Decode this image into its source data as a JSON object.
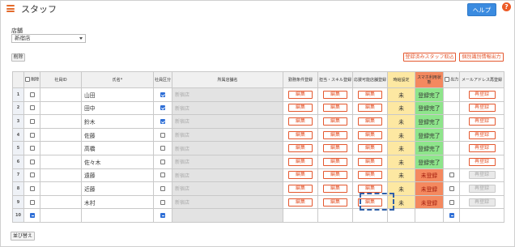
{
  "app": {
    "title": "スタッフ",
    "help_label": "ヘルプ",
    "help_icon": "?"
  },
  "store": {
    "label": "店舗",
    "selected": "新宿店"
  },
  "toolbar": {
    "delete_label": "削除",
    "sort_label": "並び替え"
  },
  "actions": {
    "registered_out_label": "登録済みスタッフ取込",
    "individual_out_label": "個別識別情報出力"
  },
  "columns": {
    "delete": "削除",
    "staff_id": "社員ID",
    "name": "氏名*",
    "staff_type": "社員区分",
    "store": "所属店舗名",
    "work_cond": "勤務条件登録",
    "skill": "担当・スキル登録",
    "shop_avail": "応援可能店舗登録",
    "time_set": "時給設定",
    "phone": "スマホ利用状態",
    "output": "出力",
    "mail": "メールアドレス再登録"
  },
  "labels": {
    "edit": "編集",
    "rereg": "再登録"
  },
  "rows": [
    {
      "num": "1",
      "name": "山田",
      "type_checked": true,
      "store": "新宿店",
      "time": "未",
      "phone": "登録完了",
      "phone_state": "ok",
      "output_cb": false,
      "rereg_enabled": true
    },
    {
      "num": "2",
      "name": "田中",
      "type_checked": true,
      "store": "新宿店",
      "time": "未",
      "phone": "登録完了",
      "phone_state": "ok",
      "output_cb": false,
      "rereg_enabled": true
    },
    {
      "num": "3",
      "name": "鈴木",
      "type_checked": true,
      "store": "新宿店",
      "time": "未",
      "phone": "登録完了",
      "phone_state": "ok",
      "output_cb": false,
      "rereg_enabled": true
    },
    {
      "num": "4",
      "name": "佐藤",
      "type_checked": false,
      "store": "新宿店",
      "time": "未",
      "phone": "登録完了",
      "phone_state": "ok",
      "output_cb": false,
      "rereg_enabled": true
    },
    {
      "num": "5",
      "name": "高橋",
      "type_checked": false,
      "store": "新宿店",
      "time": "未",
      "phone": "登録完了",
      "phone_state": "ok",
      "output_cb": false,
      "rereg_enabled": true
    },
    {
      "num": "6",
      "name": "佐々木",
      "type_checked": false,
      "store": "新宿店",
      "time": "未",
      "phone": "登録完了",
      "phone_state": "ok",
      "output_cb": false,
      "rereg_enabled": true
    },
    {
      "num": "7",
      "name": "遠藤",
      "type_checked": false,
      "store": "新宿店",
      "time": "未",
      "phone": "未登録",
      "phone_state": "ng",
      "output_cb": true,
      "rereg_enabled": false
    },
    {
      "num": "8",
      "name": "近藤",
      "type_checked": false,
      "store": "新宿店",
      "time": "未",
      "phone": "未登録",
      "phone_state": "ng",
      "output_cb": true,
      "rereg_enabled": false
    },
    {
      "num": "9",
      "name": "木村",
      "type_checked": false,
      "store": "新宿店",
      "time": "未",
      "phone": "未登録",
      "phone_state": "ng",
      "output_cb": true,
      "rereg_enabled": false
    },
    {
      "num": "10",
      "name": "",
      "type_checked": false,
      "store": "",
      "time": "",
      "phone": "",
      "phone_state": "none",
      "output_cb": false,
      "rereg_enabled": false,
      "new_row": true
    }
  ],
  "colors": {
    "accent": "#e4572e",
    "help_blue": "#3a8be0",
    "ok_green": "#8ee58b",
    "ng_orange": "#f4895f",
    "time_yellow": "#fde8a2"
  }
}
